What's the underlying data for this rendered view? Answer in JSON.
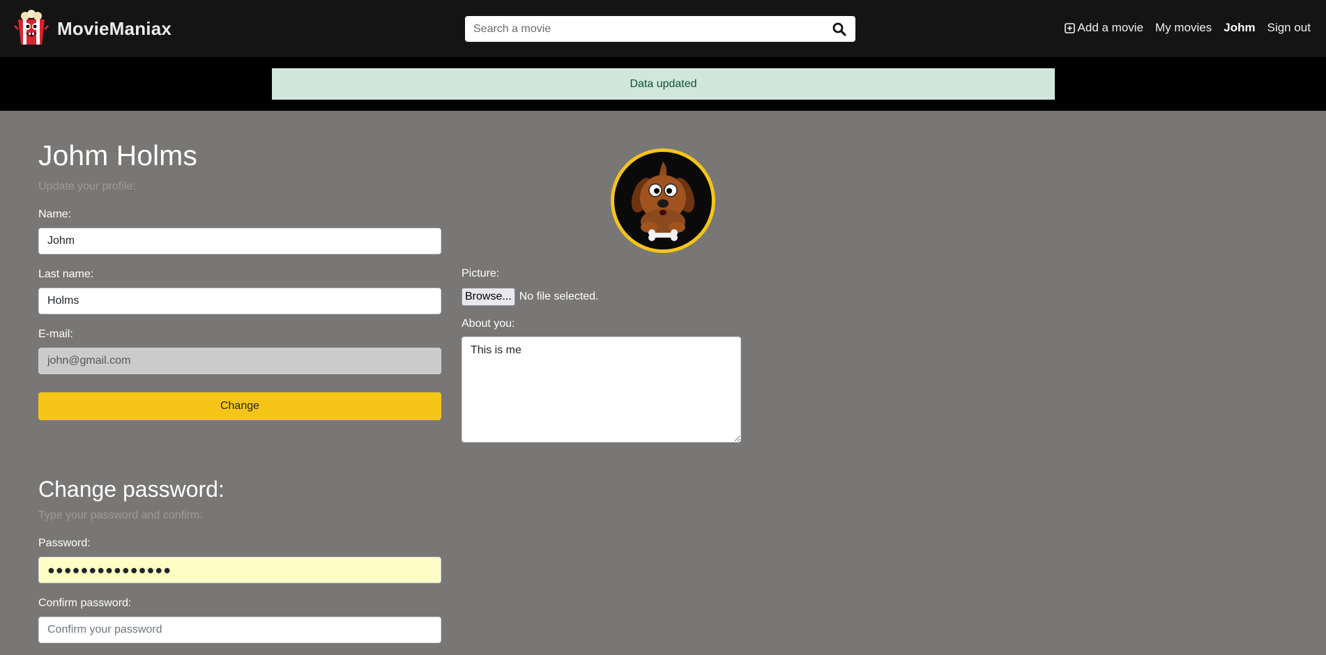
{
  "brand": {
    "name": "MovieManiax",
    "logo_icon": "popcorn-mascot-icon"
  },
  "search": {
    "placeholder": "Search a movie",
    "value": "",
    "icon": "search-icon"
  },
  "nav": {
    "add_movie": "Add a movie",
    "add_movie_icon": "plus-square-icon",
    "my_movies": "My movies",
    "user": "Johm",
    "sign_out": "Sign out"
  },
  "alert": {
    "message": "Data updated"
  },
  "profile": {
    "title": "Johm Holms",
    "subtitle": "Update your profile:",
    "name_label": "Name:",
    "name_value": "Johm",
    "lastname_label": "Last name:",
    "lastname_value": "Holms",
    "email_label": "E-mail:",
    "email_value": "john@gmail.com",
    "change_button": "Change",
    "avatar_icon": "dog-avatar",
    "picture_label": "Picture:",
    "browse_button": "Browse...",
    "file_status": "No file selected.",
    "about_label": "About you:",
    "about_value": "This is me"
  },
  "password": {
    "title": "Change password:",
    "subtitle": "Type your password and confirm:",
    "password_label": "Password:",
    "password_value": "●●●●●●●●●●●●●●●",
    "confirm_label": "Confirm password:",
    "confirm_placeholder": "Confirm your password"
  },
  "colors": {
    "navbar": "#141414",
    "page_background": "#797775",
    "accent": "#f5c518",
    "alert_background": "#d1e7dd",
    "alert_text": "#0f5132"
  }
}
